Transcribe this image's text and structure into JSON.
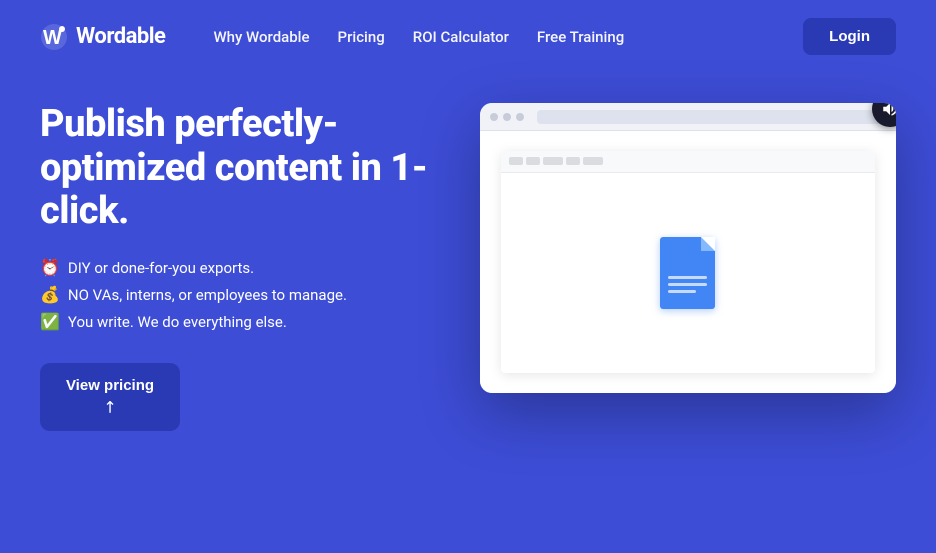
{
  "brand": {
    "name": "Wordable",
    "logo_alt": "Wordable logo"
  },
  "nav": {
    "links": [
      {
        "id": "why-wordable",
        "label": "Why Wordable"
      },
      {
        "id": "pricing",
        "label": "Pricing"
      },
      {
        "id": "roi-calculator",
        "label": "ROI Calculator"
      },
      {
        "id": "free-training",
        "label": "Free Training"
      }
    ],
    "login_label": "Login"
  },
  "hero": {
    "heading": "Publish perfectly-optimized content in 1-click.",
    "features": [
      {
        "emoji": "⏰",
        "text": "DIY or done-for-you exports."
      },
      {
        "emoji": "💰",
        "text": "NO VAs, interns, or employees to manage."
      },
      {
        "emoji": "✅",
        "text": "You write. We do everything else."
      }
    ],
    "cta_label": "View pricing",
    "cta_arrow": "↗"
  },
  "browser_mockup": {
    "alt": "Wordable app interface with Google Docs integration"
  },
  "sound_button": {
    "alt": "mute/unmute video"
  }
}
